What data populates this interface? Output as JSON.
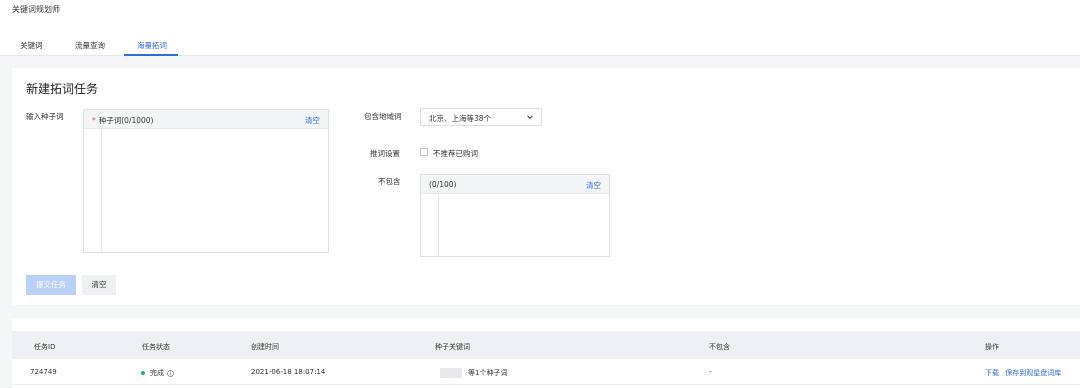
{
  "app": {
    "title": "关键词规划师"
  },
  "tabs": [
    {
      "label": "关键词",
      "active": false
    },
    {
      "label": "流量查询",
      "active": false
    },
    {
      "label": "海量拓词",
      "active": true
    }
  ],
  "form": {
    "title": "新建拓词任务",
    "seed_label": "输入种子词",
    "seed_box_title": "种子词(0/1000)",
    "seed_required_mark": "*",
    "seed_clear": "清空",
    "region_label": "包含地域词",
    "region_value": "北京、上海等38个",
    "recommend_label": "推词设置",
    "recommend_option": "不推荐已购词",
    "exclude_label": "不包含",
    "exclude_box_title": "(0/100)",
    "exclude_clear": "清空",
    "submit_label": "提交任务",
    "reset_label": "清空"
  },
  "table": {
    "columns": [
      "任务ID",
      "任务状态",
      "创建时间",
      "种子关键词",
      "不包含",
      "操作"
    ],
    "rows": [
      {
        "id": "724749",
        "status": "完成",
        "created": "2021-06-18 18:07:14",
        "seed": "等1个种子词",
        "exclude": "-",
        "action_download": "下载",
        "action_save": "保存到观星盘词库"
      }
    ]
  },
  "colors": {
    "accent": "#2f6bdb",
    "success": "#2bb35f",
    "required": "#e54545"
  }
}
